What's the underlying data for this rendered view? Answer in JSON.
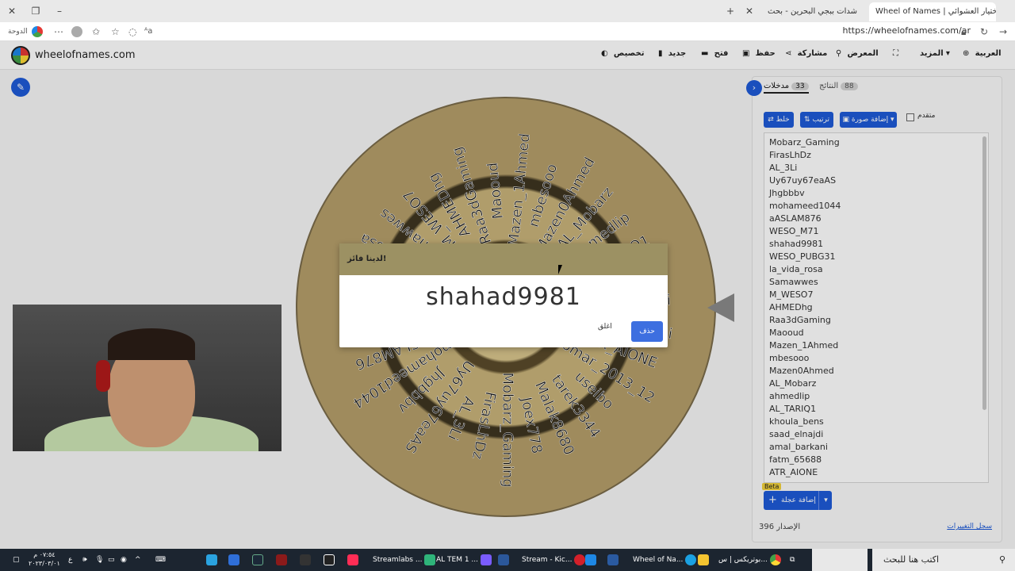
{
  "browser": {
    "tabs": [
      {
        "label": "Wheel of Names | عجلة الاختيار العشوائي",
        "active": true
      },
      {
        "label": "شدات ببجي البحرين - بحث",
        "active": false
      }
    ],
    "url": "https://wheelofnames.com/ar",
    "left_label": "الدوحة"
  },
  "app": {
    "brand": "wheelofnames.com",
    "menu": {
      "customize": "تخصيص",
      "new": "جديد",
      "open": "فتح",
      "save": "حفظ",
      "share": "مشاركة",
      "gallery": "المعرض",
      "more": "المزيد",
      "language": "العربية"
    }
  },
  "wheel": {
    "labels": [
      "Mobarz_Gaming",
      "FirasLhDz",
      "AL_3Li",
      "Uy67uy67eaAS",
      "Jhgbbbv",
      "mohameed1044",
      "aASLAM876",
      "WESO_M71",
      "shahad9981",
      "WESO_PUBG31",
      "la_vida_rosa",
      "Samawwes",
      "M_WESO7",
      "AHMEDhg",
      "Raa3dGaming",
      "Maooud",
      "Mazen_1Ahmed",
      "mbesooo",
      "Mazen0Ahmed",
      "AL_Mobarz",
      "ahmedlip",
      "AL_TARIQ1",
      "khoula_bens",
      "saad_elnajdi",
      "amal_barkani",
      "ATR_AIONE",
      "omar_2013_12",
      "useibo",
      "tarek3344",
      "Malak8680",
      "Joex778"
    ]
  },
  "panel": {
    "tab_entries": "مدخلات",
    "entries_count": "33",
    "tab_results": "النتائج",
    "results_count": "88",
    "shuffle": "خلط",
    "sort": "ترتيب",
    "add_image": "إضافة صورة",
    "advanced": "متقدم",
    "entries": [
      "Mobarz_Gaming",
      "FirasLhDz",
      "AL_3Li",
      "Uy67uy67eaAS",
      "Jhgbbbv",
      "mohameed1044",
      "aASLAM876",
      "WESO_M71",
      "shahad9981",
      "WESO_PUBG31",
      "la_vida_rosa",
      "Samawwes",
      "M_WESO7",
      "AHMEDhg",
      "Raa3dGaming",
      "Maooud",
      "Mazen_1Ahmed",
      "mbesooo",
      "Mazen0Ahmed",
      "AL_Mobarz",
      "ahmedlip",
      "AL_TARIQ1",
      "khoula_bens",
      "saad_elnajdi",
      "amal_barkani",
      "fatm_65688",
      "ATR_AIONE"
    ],
    "beta": "Beta",
    "add_wheel": "إضافة عجلة",
    "version_label": "الإصدار",
    "version": "396",
    "changelog": "سجل التغييرات"
  },
  "dialog": {
    "title": "لدينا فائز!",
    "winner": "shahad9981",
    "close": "اغلق",
    "remove": "حذف"
  },
  "taskbar": {
    "search": "اكتب هنا للبحث",
    "items": [
      "بوتريكس | س...",
      "Wheel of Na...",
      "Stream - Kic...",
      "AL TEM 1 ...",
      "Streamlabs ..."
    ],
    "time": "٠٧:٥٤ م",
    "date": "٢٠٢٣/٠٣/٠١"
  },
  "colors": {
    "accent": "#1e5bd8",
    "dialog_header": "#9c9163",
    "taskbar": "#1c2530"
  }
}
